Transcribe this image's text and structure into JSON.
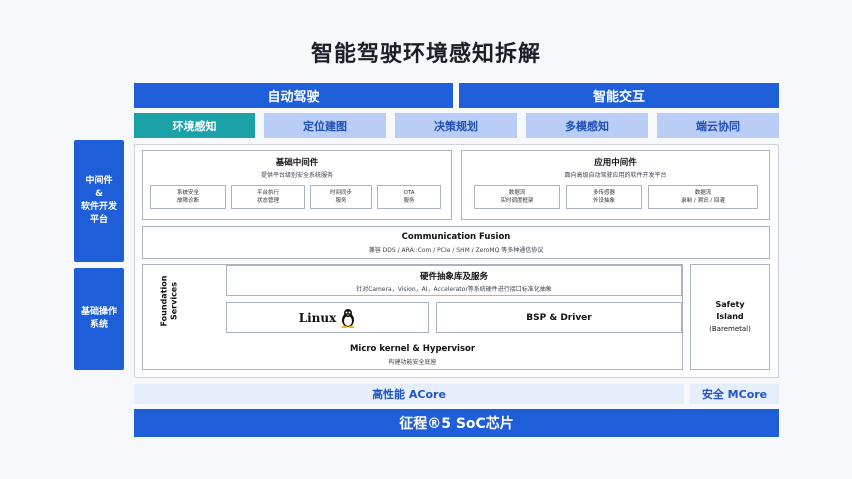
{
  "title": "智能驾驶环境感知拆解",
  "top_bars": {
    "left": "自动驾驶",
    "right": "智能交互"
  },
  "tabs": [
    {
      "label": "环境感知"
    },
    {
      "label": "定位建图"
    },
    {
      "label": "决策规划"
    },
    {
      "label": "多模感知"
    },
    {
      "label": "端云协同"
    }
  ],
  "side_labels": {
    "middleware": [
      "中间件",
      "&",
      "软件开发",
      "平台"
    ],
    "base_os": [
      "基础操作",
      "系统"
    ]
  },
  "basic_middleware": {
    "title": "基础中间件",
    "subtitle": "提供平台级别安全系统服务",
    "items": [
      [
        "系统安全",
        "故障诊断"
      ],
      [
        "平台执行",
        "状态管理"
      ],
      [
        "时间同步",
        "服务"
      ],
      [
        "OTA",
        "服务"
      ]
    ]
  },
  "app_middleware": {
    "title": "应用中间件",
    "subtitle": "面向高级自动驾驶应用的软件开发平台",
    "items": [
      [
        "数据流",
        "实时调度框架"
      ],
      [
        "多传感器",
        "外设抽象"
      ],
      [
        "数据流",
        "录制 / 溯讯 / 回灌"
      ]
    ]
  },
  "comm_fusion": {
    "title": "Communication Fusion",
    "subtitle": "兼容 DDS / ARA::Com / PCIe / SHM / ZeroMQ 等多种通信协议"
  },
  "foundation": [
    "Foundation",
    "Services"
  ],
  "hw_abstraction": {
    "title": "硬件抽象库及服务",
    "subtitle": "针对Camera，Vision，AI，Accelerator等系统硬件进行接口标准化抽象"
  },
  "linux_logo": "Linux",
  "bsp": "BSP & Driver",
  "micro_kernel": {
    "title": "Micro kernel & Hypervisor",
    "subtitle": "构建功能安全底座"
  },
  "safety_island": [
    "Safety",
    "Island",
    "(Baremetal)"
  ],
  "acore": "高性能 ACore",
  "mcore": "安全 MCore",
  "soc": "征程®5 SoC芯片"
}
